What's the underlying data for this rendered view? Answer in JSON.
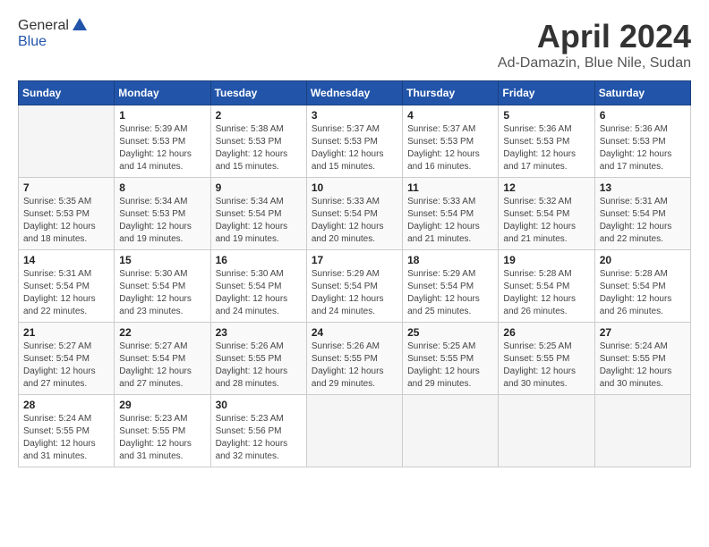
{
  "header": {
    "logo_line1": "General",
    "logo_line2": "Blue",
    "title": "April 2024",
    "subtitle": "Ad-Damazin, Blue Nile, Sudan"
  },
  "calendar": {
    "days_of_week": [
      "Sunday",
      "Monday",
      "Tuesday",
      "Wednesday",
      "Thursday",
      "Friday",
      "Saturday"
    ],
    "weeks": [
      [
        {
          "day": "",
          "sunrise": "",
          "sunset": "",
          "daylight": ""
        },
        {
          "day": "1",
          "sunrise": "Sunrise: 5:39 AM",
          "sunset": "Sunset: 5:53 PM",
          "daylight": "Daylight: 12 hours and 14 minutes."
        },
        {
          "day": "2",
          "sunrise": "Sunrise: 5:38 AM",
          "sunset": "Sunset: 5:53 PM",
          "daylight": "Daylight: 12 hours and 15 minutes."
        },
        {
          "day": "3",
          "sunrise": "Sunrise: 5:37 AM",
          "sunset": "Sunset: 5:53 PM",
          "daylight": "Daylight: 12 hours and 15 minutes."
        },
        {
          "day": "4",
          "sunrise": "Sunrise: 5:37 AM",
          "sunset": "Sunset: 5:53 PM",
          "daylight": "Daylight: 12 hours and 16 minutes."
        },
        {
          "day": "5",
          "sunrise": "Sunrise: 5:36 AM",
          "sunset": "Sunset: 5:53 PM",
          "daylight": "Daylight: 12 hours and 17 minutes."
        },
        {
          "day": "6",
          "sunrise": "Sunrise: 5:36 AM",
          "sunset": "Sunset: 5:53 PM",
          "daylight": "Daylight: 12 hours and 17 minutes."
        }
      ],
      [
        {
          "day": "7",
          "sunrise": "Sunrise: 5:35 AM",
          "sunset": "Sunset: 5:53 PM",
          "daylight": "Daylight: 12 hours and 18 minutes."
        },
        {
          "day": "8",
          "sunrise": "Sunrise: 5:34 AM",
          "sunset": "Sunset: 5:53 PM",
          "daylight": "Daylight: 12 hours and 19 minutes."
        },
        {
          "day": "9",
          "sunrise": "Sunrise: 5:34 AM",
          "sunset": "Sunset: 5:54 PM",
          "daylight": "Daylight: 12 hours and 19 minutes."
        },
        {
          "day": "10",
          "sunrise": "Sunrise: 5:33 AM",
          "sunset": "Sunset: 5:54 PM",
          "daylight": "Daylight: 12 hours and 20 minutes."
        },
        {
          "day": "11",
          "sunrise": "Sunrise: 5:33 AM",
          "sunset": "Sunset: 5:54 PM",
          "daylight": "Daylight: 12 hours and 21 minutes."
        },
        {
          "day": "12",
          "sunrise": "Sunrise: 5:32 AM",
          "sunset": "Sunset: 5:54 PM",
          "daylight": "Daylight: 12 hours and 21 minutes."
        },
        {
          "day": "13",
          "sunrise": "Sunrise: 5:31 AM",
          "sunset": "Sunset: 5:54 PM",
          "daylight": "Daylight: 12 hours and 22 minutes."
        }
      ],
      [
        {
          "day": "14",
          "sunrise": "Sunrise: 5:31 AM",
          "sunset": "Sunset: 5:54 PM",
          "daylight": "Daylight: 12 hours and 22 minutes."
        },
        {
          "day": "15",
          "sunrise": "Sunrise: 5:30 AM",
          "sunset": "Sunset: 5:54 PM",
          "daylight": "Daylight: 12 hours and 23 minutes."
        },
        {
          "day": "16",
          "sunrise": "Sunrise: 5:30 AM",
          "sunset": "Sunset: 5:54 PM",
          "daylight": "Daylight: 12 hours and 24 minutes."
        },
        {
          "day": "17",
          "sunrise": "Sunrise: 5:29 AM",
          "sunset": "Sunset: 5:54 PM",
          "daylight": "Daylight: 12 hours and 24 minutes."
        },
        {
          "day": "18",
          "sunrise": "Sunrise: 5:29 AM",
          "sunset": "Sunset: 5:54 PM",
          "daylight": "Daylight: 12 hours and 25 minutes."
        },
        {
          "day": "19",
          "sunrise": "Sunrise: 5:28 AM",
          "sunset": "Sunset: 5:54 PM",
          "daylight": "Daylight: 12 hours and 26 minutes."
        },
        {
          "day": "20",
          "sunrise": "Sunrise: 5:28 AM",
          "sunset": "Sunset: 5:54 PM",
          "daylight": "Daylight: 12 hours and 26 minutes."
        }
      ],
      [
        {
          "day": "21",
          "sunrise": "Sunrise: 5:27 AM",
          "sunset": "Sunset: 5:54 PM",
          "daylight": "Daylight: 12 hours and 27 minutes."
        },
        {
          "day": "22",
          "sunrise": "Sunrise: 5:27 AM",
          "sunset": "Sunset: 5:54 PM",
          "daylight": "Daylight: 12 hours and 27 minutes."
        },
        {
          "day": "23",
          "sunrise": "Sunrise: 5:26 AM",
          "sunset": "Sunset: 5:55 PM",
          "daylight": "Daylight: 12 hours and 28 minutes."
        },
        {
          "day": "24",
          "sunrise": "Sunrise: 5:26 AM",
          "sunset": "Sunset: 5:55 PM",
          "daylight": "Daylight: 12 hours and 29 minutes."
        },
        {
          "day": "25",
          "sunrise": "Sunrise: 5:25 AM",
          "sunset": "Sunset: 5:55 PM",
          "daylight": "Daylight: 12 hours and 29 minutes."
        },
        {
          "day": "26",
          "sunrise": "Sunrise: 5:25 AM",
          "sunset": "Sunset: 5:55 PM",
          "daylight": "Daylight: 12 hours and 30 minutes."
        },
        {
          "day": "27",
          "sunrise": "Sunrise: 5:24 AM",
          "sunset": "Sunset: 5:55 PM",
          "daylight": "Daylight: 12 hours and 30 minutes."
        }
      ],
      [
        {
          "day": "28",
          "sunrise": "Sunrise: 5:24 AM",
          "sunset": "Sunset: 5:55 PM",
          "daylight": "Daylight: 12 hours and 31 minutes."
        },
        {
          "day": "29",
          "sunrise": "Sunrise: 5:23 AM",
          "sunset": "Sunset: 5:55 PM",
          "daylight": "Daylight: 12 hours and 31 minutes."
        },
        {
          "day": "30",
          "sunrise": "Sunrise: 5:23 AM",
          "sunset": "Sunset: 5:56 PM",
          "daylight": "Daylight: 12 hours and 32 minutes."
        },
        {
          "day": "",
          "sunrise": "",
          "sunset": "",
          "daylight": ""
        },
        {
          "day": "",
          "sunrise": "",
          "sunset": "",
          "daylight": ""
        },
        {
          "day": "",
          "sunrise": "",
          "sunset": "",
          "daylight": ""
        },
        {
          "day": "",
          "sunrise": "",
          "sunset": "",
          "daylight": ""
        }
      ]
    ]
  }
}
